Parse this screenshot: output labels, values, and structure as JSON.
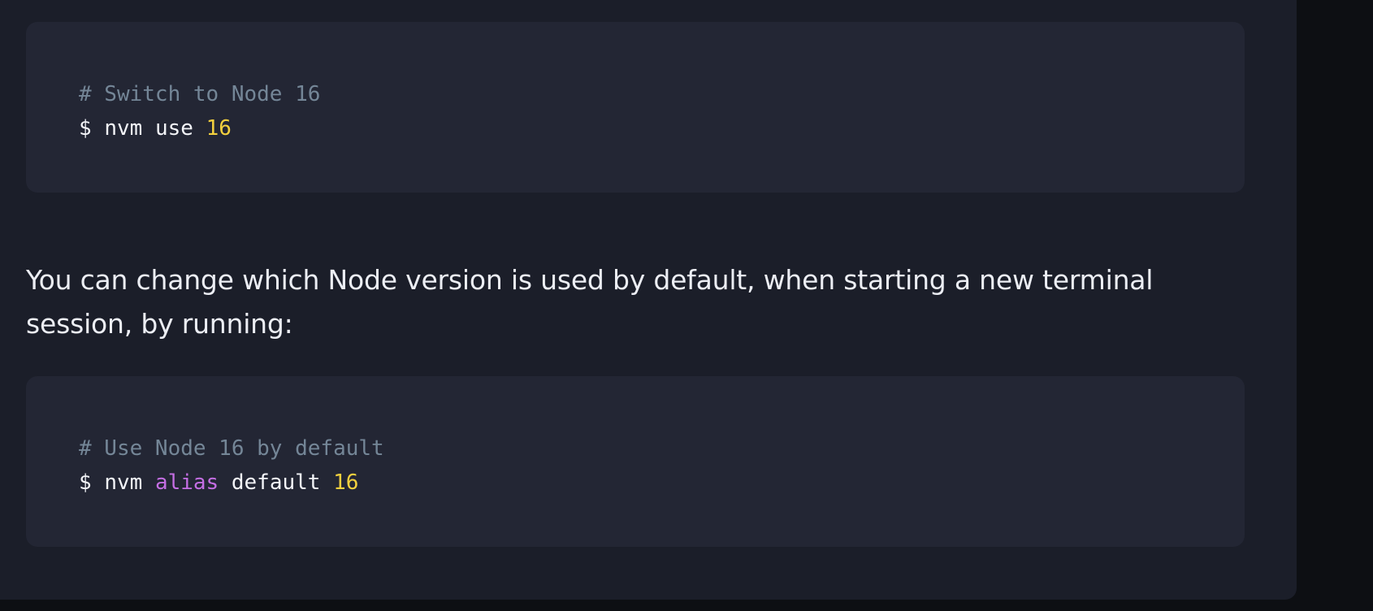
{
  "colors": {
    "page_background": "#0d0f13",
    "panel_background": "#1b1e29",
    "code_background": "#232634",
    "comment": "#748697",
    "plain_text": "#f3f4f8",
    "number": "#f3d03e",
    "keyword": "#c46ee3"
  },
  "code_blocks": [
    {
      "comment": "# Switch to Node 16",
      "command": {
        "prompt": "$",
        "program": "nvm",
        "subcommand": "use",
        "argument": "16"
      }
    },
    {
      "comment": "# Use Node 16 by default",
      "command": {
        "prompt": "$",
        "program": "nvm",
        "subcommand": "alias",
        "argument_1": "default",
        "argument_2": "16"
      }
    }
  ],
  "paragraph": {
    "text": "You can change which Node version is used by default, when starting a new terminal session, by running:"
  }
}
